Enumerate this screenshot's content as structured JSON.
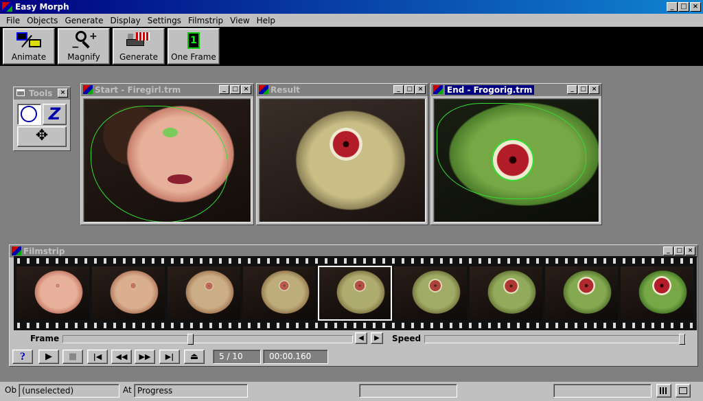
{
  "app": {
    "title": "Easy Morph"
  },
  "menu": [
    "File",
    "Objects",
    "Generate",
    "Display",
    "Settings",
    "Filmstrip",
    "View",
    "Help"
  ],
  "toolbar": {
    "animate": "Animate",
    "magnify": "Magnify",
    "generate": "Generate",
    "one_frame": "One Frame",
    "one_frame_icon_digit": "1"
  },
  "windows": {
    "tools": "Tools",
    "start": "Start - Firegirl.trm",
    "result": "Result",
    "end": "End - Frogorig.trm"
  },
  "filmstrip": {
    "title": "Filmstrip",
    "frame_label": "Frame",
    "speed_label": "Speed",
    "frame_counter": "5 / 10",
    "time": "00:00.160",
    "frame_count_shown": 9,
    "selected_frame": 5,
    "frame_slider_fraction": 0.44,
    "speed_slider_fraction": 1.0
  },
  "playback": {
    "help": "?",
    "play": "▶",
    "stop": "■",
    "first": "|◀",
    "rewind": "◀◀",
    "forward": "▶▶",
    "last": "▶|",
    "eject": "⏏"
  },
  "status": {
    "ob_label": "Ob",
    "ob_value": "(unselected)",
    "at_label": "At",
    "at_value": "Progress"
  }
}
